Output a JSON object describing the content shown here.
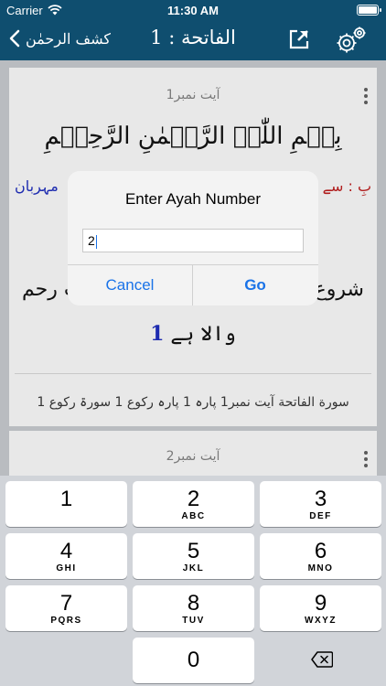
{
  "status_bar": {
    "carrier": "Carrier",
    "time": "11:30 AM"
  },
  "nav": {
    "back_label": "کشف الرحمٰن",
    "title": "الفاتحة : 1",
    "bar_color": "#0f4e6f"
  },
  "card1": {
    "ayah_label": "آیت نمبر1",
    "arabic": "بِسۡمِ اللّٰہِ الرَّحۡمٰنِ الرَّحِیۡمِ",
    "wbw_left": "مہربان",
    "wbw_right": "بِ : سے",
    "translation_line1_left": "ت رحم",
    "translation_line1_right": "شروع",
    "translation_line2": "والا ہے",
    "translation_number": "1",
    "reference": "سورة الفاتحة آیت نمبر1   پارہ 1 پارہ رکوع 1  سورۃ رکوع 1"
  },
  "card2": {
    "ayah_label": "آیت نمبر2"
  },
  "alert": {
    "title": "Enter Ayah Number",
    "input_value": "2",
    "cancel": "Cancel",
    "go": "Go",
    "accent_color": "#1a73e8"
  },
  "keyboard": {
    "keys": [
      {
        "digit": "1",
        "letters": ""
      },
      {
        "digit": "2",
        "letters": "ABC"
      },
      {
        "digit": "3",
        "letters": "DEF"
      },
      {
        "digit": "4",
        "letters": "GHI"
      },
      {
        "digit": "5",
        "letters": "JKL"
      },
      {
        "digit": "6",
        "letters": "MNO"
      },
      {
        "digit": "7",
        "letters": "PQRS"
      },
      {
        "digit": "8",
        "letters": "TUV"
      },
      {
        "digit": "9",
        "letters": "WXYZ"
      }
    ],
    "zero": "0",
    "delete_icon": "backspace-icon"
  }
}
